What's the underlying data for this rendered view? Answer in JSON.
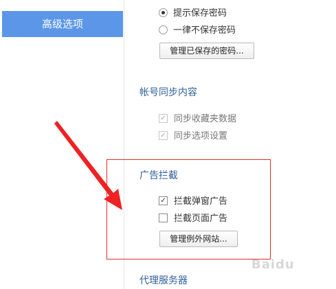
{
  "sidebar": {
    "active_item": "高级选项"
  },
  "password": {
    "options": [
      {
        "label": "提示保存密码",
        "checked": true
      },
      {
        "label": "一律不保存密码",
        "checked": false
      }
    ],
    "manage_button": "管理已保存的密码..."
  },
  "sync": {
    "title": "帐号同步内容",
    "options": [
      {
        "label": "同步收藏夹数据",
        "checked": true,
        "disabled": true
      },
      {
        "label": "同步选项设置",
        "checked": true,
        "disabled": true
      }
    ]
  },
  "adblock": {
    "title": "广告拦截",
    "options": [
      {
        "label": "拦截弹窗广告",
        "checked": true
      },
      {
        "label": "拦截页面广告",
        "checked": false
      }
    ],
    "manage_button": "管理例外网站..."
  },
  "proxy": {
    "title": "代理服务器"
  },
  "annotation": {
    "color": "#e22a2a"
  },
  "watermark": "Baidu"
}
